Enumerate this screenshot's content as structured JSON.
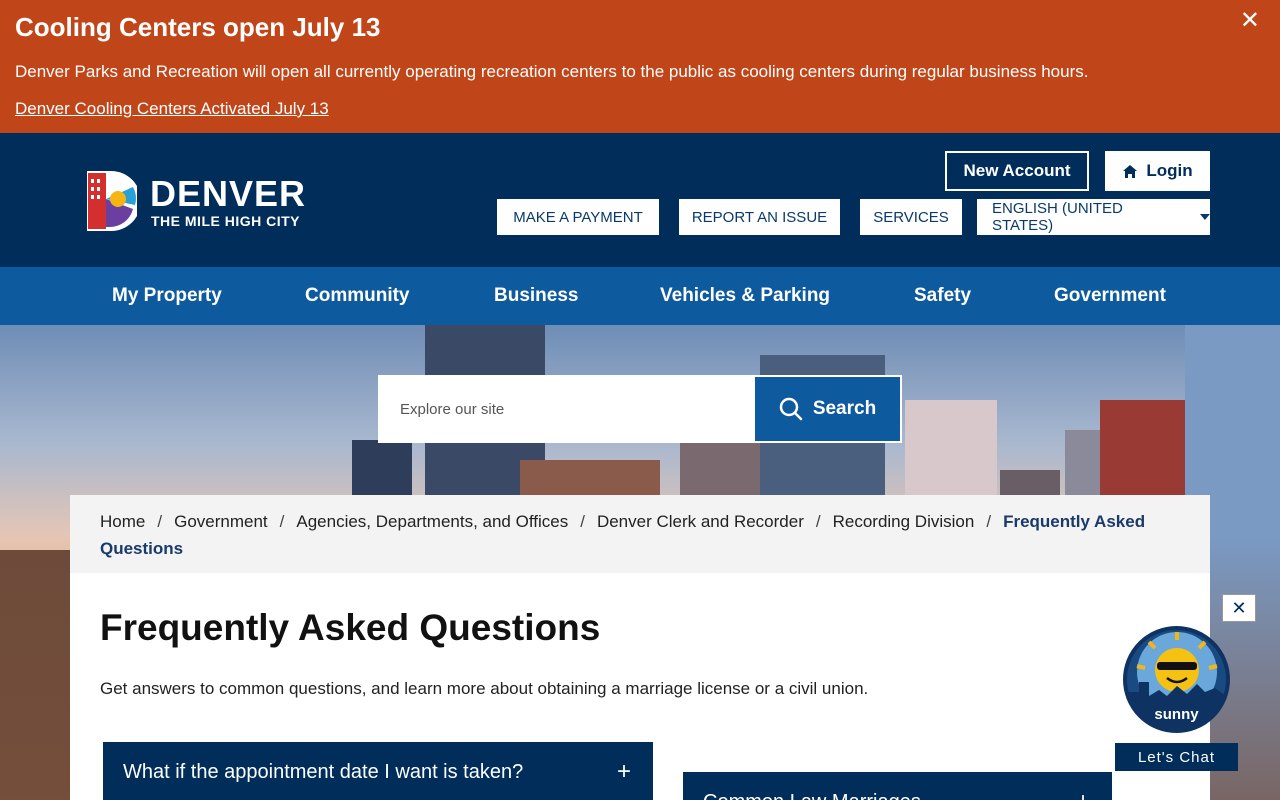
{
  "alert": {
    "title": "Cooling Centers open July 13",
    "text": "Denver Parks and Recreation will open all currently operating recreation centers to the public as cooling centers during regular business hours.",
    "link": "Denver Cooling Centers Activated July 13",
    "close": "✕"
  },
  "header": {
    "logo_word": "DENVER",
    "logo_sub": "THE MILE HIGH CITY",
    "new_account": "New Account",
    "login": "Login",
    "make_payment": "MAKE A PAYMENT",
    "report_issue": "REPORT AN ISSUE",
    "services": "SERVICES",
    "language": "ENGLISH (UNITED STATES)"
  },
  "nav": {
    "items": [
      "My Property",
      "Community",
      "Business",
      "Vehicles & Parking",
      "Safety",
      "Government"
    ]
  },
  "search": {
    "placeholder": "Explore our site",
    "button": "Search"
  },
  "breadcrumb": {
    "items": [
      "Home",
      "Government",
      "Agencies, Departments, and Offices",
      "Denver Clerk and Recorder",
      "Recording Division"
    ],
    "current": "Frequently Asked Questions",
    "separator": "/"
  },
  "main": {
    "title": "Frequently Asked Questions",
    "intro": "Get answers to common questions, and learn more about obtaining a marriage license or a civil union.",
    "accordions": [
      {
        "label": "What if the appointment date I want is taken?",
        "icon": "+"
      },
      {
        "label": "Common Law Marriages",
        "icon": "+"
      }
    ]
  },
  "chat": {
    "close": "✕",
    "name": "sunny",
    "label": "Let's Chat"
  },
  "colors": {
    "alert": "#c0461a",
    "header": "#002d5a",
    "nav": "#0e5a9e"
  }
}
